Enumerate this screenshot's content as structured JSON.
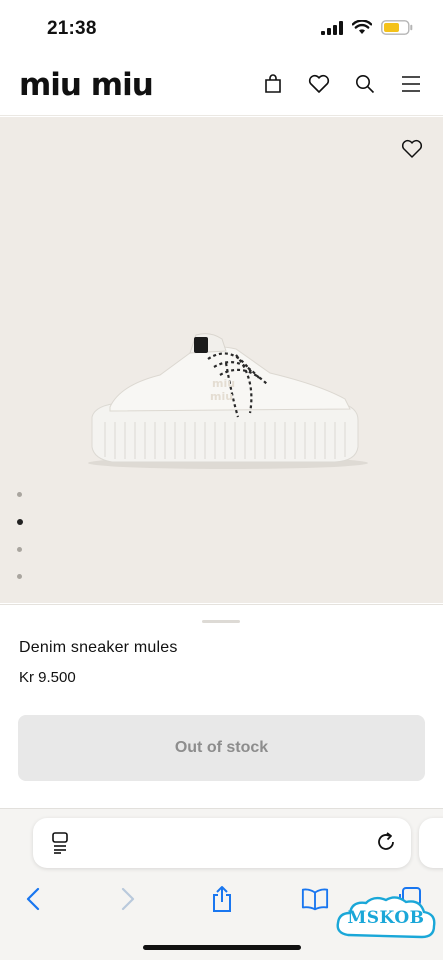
{
  "status_bar": {
    "time": "21:38"
  },
  "header": {
    "logo": "miu miu"
  },
  "product": {
    "name": "Denim sneaker mules",
    "price": "Kr 9.500",
    "cta_label": "Out of stock"
  },
  "gallery": {
    "image_count": 4,
    "active_index": 1
  },
  "watermark": {
    "text": "MSKOB"
  },
  "colors": {
    "accent_blue": "#1976f0",
    "battery_yellow": "#f4c21a",
    "background_beige": "#efebe6"
  }
}
